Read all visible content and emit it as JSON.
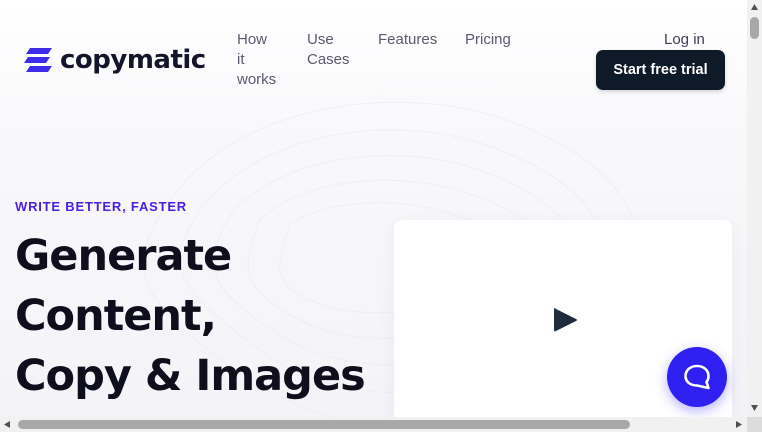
{
  "brand": {
    "name": "copymatic",
    "accent": "#4c1fe0",
    "logo_color": "#3d2de8"
  },
  "nav": {
    "items": [
      {
        "id": "how",
        "label": "How it works"
      },
      {
        "id": "use",
        "label": "Use Cases"
      },
      {
        "id": "features",
        "label": "Features"
      },
      {
        "id": "pricing",
        "label": "Pricing"
      }
    ],
    "login": "Log in",
    "cta": "Start free trial"
  },
  "hero": {
    "eyebrow": "WRITE BETTER, FASTER",
    "headline_lines": [
      "Generate",
      "Content,",
      "Copy & Images"
    ]
  },
  "video": {
    "icon": "play-icon"
  },
  "chat": {
    "icon": "chat-bubble-icon",
    "color": "#2f1ff0"
  }
}
